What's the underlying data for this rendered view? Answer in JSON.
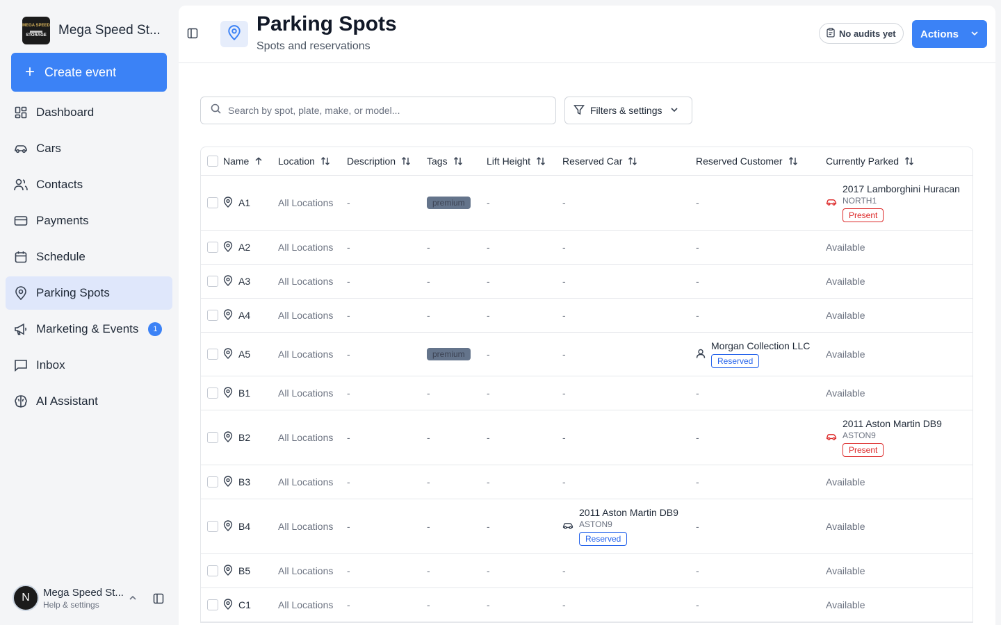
{
  "brand": {
    "name": "Mega Speed St...",
    "logo_text": [
      "MEGA SPEED",
      "STORAGE"
    ]
  },
  "create_event_label": "Create event",
  "nav": [
    {
      "label": "Dashboard",
      "icon": "dashboard-icon",
      "active": false
    },
    {
      "label": "Cars",
      "icon": "car-icon",
      "active": false
    },
    {
      "label": "Contacts",
      "icon": "contacts-icon",
      "active": false
    },
    {
      "label": "Payments",
      "icon": "credit-card-icon",
      "active": false
    },
    {
      "label": "Schedule",
      "icon": "calendar-icon",
      "active": false
    },
    {
      "label": "Parking Spots",
      "icon": "map-pin-icon",
      "active": true
    },
    {
      "label": "Marketing & Events",
      "icon": "megaphone-icon",
      "active": false,
      "badge": "1"
    },
    {
      "label": "Inbox",
      "icon": "inbox-icon",
      "active": false
    },
    {
      "label": "AI Assistant",
      "icon": "brain-icon",
      "active": false
    }
  ],
  "user": {
    "initial": "N",
    "name": "Mega Speed St...",
    "sub": "Help & settings"
  },
  "header": {
    "title": "Parking Spots",
    "subtitle": "Spots and reservations",
    "audit_label": "No audits yet",
    "actions_label": "Actions"
  },
  "search": {
    "placeholder": "Search by spot, plate, make, or model..."
  },
  "filters_label": "Filters & settings",
  "table": {
    "columns": [
      "Name",
      "Location",
      "Description",
      "Tags",
      "Lift Height",
      "Reserved Car",
      "Reserved Customer",
      "Currently Parked"
    ],
    "rows": [
      {
        "name": "A1",
        "location": "All Locations",
        "description": "-",
        "tag": "premium",
        "lift": "-",
        "reserved_car": null,
        "reserved_customer": null,
        "parked": {
          "title": "2017 Lamborghini Huracan",
          "plate": "NORTH1",
          "status": "Present"
        }
      },
      {
        "name": "A2",
        "location": "All Locations",
        "description": "-",
        "tag": null,
        "lift": "-",
        "reserved_car": null,
        "reserved_customer": null,
        "parked": null
      },
      {
        "name": "A3",
        "location": "All Locations",
        "description": "-",
        "tag": null,
        "lift": "-",
        "reserved_car": null,
        "reserved_customer": null,
        "parked": null
      },
      {
        "name": "A4",
        "location": "All Locations",
        "description": "-",
        "tag": null,
        "lift": "-",
        "reserved_car": null,
        "reserved_customer": null,
        "parked": null
      },
      {
        "name": "A5",
        "location": "All Locations",
        "description": "-",
        "tag": "premium",
        "lift": "-",
        "reserved_car": null,
        "reserved_customer": {
          "name": "Morgan Collection LLC",
          "status": "Reserved"
        },
        "parked": null
      },
      {
        "name": "B1",
        "location": "All Locations",
        "description": "-",
        "tag": null,
        "lift": "-",
        "reserved_car": null,
        "reserved_customer": null,
        "parked": null
      },
      {
        "name": "B2",
        "location": "All Locations",
        "description": "-",
        "tag": null,
        "lift": "-",
        "reserved_car": null,
        "reserved_customer": null,
        "parked": {
          "title": "2011 Aston Martin DB9",
          "plate": "ASTON9",
          "status": "Present"
        }
      },
      {
        "name": "B3",
        "location": "All Locations",
        "description": "-",
        "tag": null,
        "lift": "-",
        "reserved_car": null,
        "reserved_customer": null,
        "parked": null
      },
      {
        "name": "B4",
        "location": "All Locations",
        "description": "-",
        "tag": null,
        "lift": "-",
        "reserved_car": {
          "title": "2011 Aston Martin DB9",
          "plate": "ASTON9",
          "status": "Reserved"
        },
        "reserved_customer": null,
        "parked": null
      },
      {
        "name": "B5",
        "location": "All Locations",
        "description": "-",
        "tag": null,
        "lift": "-",
        "reserved_car": null,
        "reserved_customer": null,
        "parked": null
      },
      {
        "name": "C1",
        "location": "All Locations",
        "description": "-",
        "tag": null,
        "lift": "-",
        "reserved_car": null,
        "reserved_customer": null,
        "parked": null
      }
    ],
    "empty_value": "-",
    "available_label": "Available"
  },
  "colors": {
    "accent": "#3b82f6",
    "active_nav": "#dfe7fb",
    "present": "#dc2626",
    "reserved": "#2563eb",
    "tag_bg": "#64748b"
  }
}
